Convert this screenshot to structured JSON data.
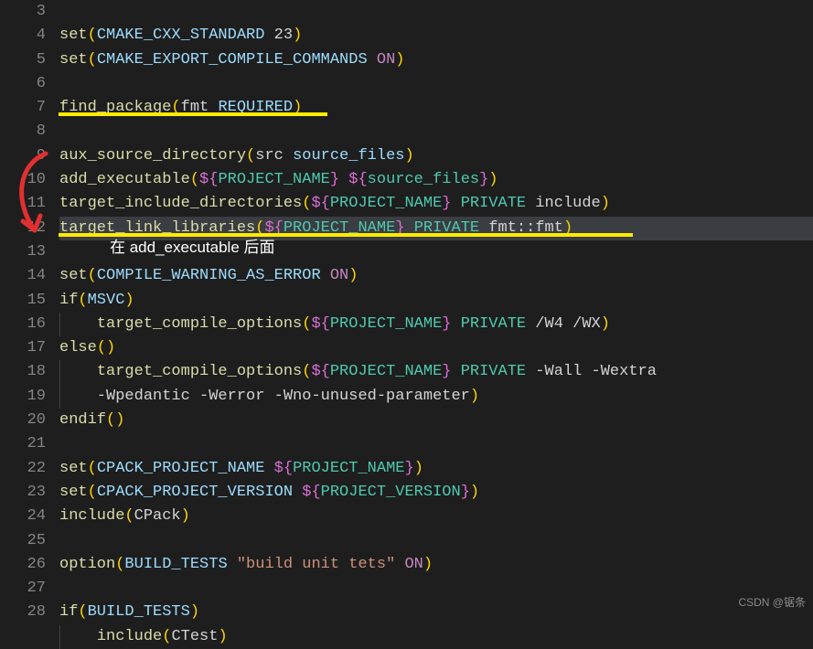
{
  "line_numbers": [
    "3",
    "4",
    "5",
    "6",
    "7",
    "8",
    "9",
    "10",
    "11",
    "12",
    "13",
    "14",
    "15",
    "16",
    "17",
    "18",
    "19",
    "20",
    "21",
    "22",
    "23",
    "24",
    "25",
    "26",
    "27",
    "28"
  ],
  "code": {
    "l4": [
      {
        "t": "set",
        "c": "tk-fn"
      },
      {
        "t": "(",
        "c": "tk-pn"
      },
      {
        "t": "CMAKE_CXX_STANDARD ",
        "c": "tk-var"
      },
      {
        "t": "23",
        "c": "tk-def"
      },
      {
        "t": ")",
        "c": "tk-pn"
      }
    ],
    "l5": [
      {
        "t": "set",
        "c": "tk-fn"
      },
      {
        "t": "(",
        "c": "tk-pn"
      },
      {
        "t": "CMAKE_EXPORT_COMPILE_COMMANDS ",
        "c": "tk-var"
      },
      {
        "t": "ON",
        "c": "tk-kw"
      },
      {
        "t": ")",
        "c": "tk-pn"
      }
    ],
    "l7": [
      {
        "t": "find_package",
        "c": "tk-fn"
      },
      {
        "t": "(",
        "c": "tk-pn"
      },
      {
        "t": "fmt ",
        "c": "tk-def"
      },
      {
        "t": "REQUIRED",
        "c": "tk-var"
      },
      {
        "t": ")",
        "c": "tk-pn"
      }
    ],
    "l9": [
      {
        "t": "aux_source_directory",
        "c": "tk-fn"
      },
      {
        "t": "(",
        "c": "tk-pn"
      },
      {
        "t": "src ",
        "c": "tk-def"
      },
      {
        "t": "source_files",
        "c": "tk-var"
      },
      {
        "t": ")",
        "c": "tk-pn"
      }
    ],
    "l10": [
      {
        "t": "add_executable",
        "c": "tk-fn"
      },
      {
        "t": "(",
        "c": "tk-pn"
      },
      {
        "t": "${",
        "c": "tk-pn2"
      },
      {
        "t": "PROJECT_NAME",
        "c": "tk-varb"
      },
      {
        "t": "}",
        "c": "tk-pn2"
      },
      {
        "t": " ",
        "c": "tk-def"
      },
      {
        "t": "${",
        "c": "tk-pn2"
      },
      {
        "t": "source_files",
        "c": "tk-varb"
      },
      {
        "t": "}",
        "c": "tk-pn2"
      },
      {
        "t": ")",
        "c": "tk-pn"
      }
    ],
    "l11": [
      {
        "t": "target_include_directories",
        "c": "tk-fn"
      },
      {
        "t": "(",
        "c": "tk-pn"
      },
      {
        "t": "${",
        "c": "tk-pn2"
      },
      {
        "t": "PROJECT_NAME",
        "c": "tk-varb"
      },
      {
        "t": "}",
        "c": "tk-pn2"
      },
      {
        "t": " ",
        "c": "tk-def"
      },
      {
        "t": "PRIVATE",
        "c": "tk-varb"
      },
      {
        "t": " include",
        "c": "tk-def"
      },
      {
        "t": ")",
        "c": "tk-pn"
      }
    ],
    "l12": [
      {
        "t": "target_link_libraries",
        "c": "tk-fn"
      },
      {
        "t": "(",
        "c": "tk-pn"
      },
      {
        "t": "${",
        "c": "tk-pn2"
      },
      {
        "t": "PROJECT_NAME",
        "c": "tk-varb"
      },
      {
        "t": "}",
        "c": "tk-pn2"
      },
      {
        "t": " ",
        "c": "tk-def"
      },
      {
        "t": "PRIVATE",
        "c": "tk-varb"
      },
      {
        "t": " fmt::fmt",
        "c": "tk-def"
      },
      {
        "t": ")",
        "c": "tk-pn"
      }
    ],
    "l14": [
      {
        "t": "set",
        "c": "tk-fn"
      },
      {
        "t": "(",
        "c": "tk-pn"
      },
      {
        "t": "COMPILE_WARNING_AS_ERROR ",
        "c": "tk-var"
      },
      {
        "t": "ON",
        "c": "tk-kw"
      },
      {
        "t": ")",
        "c": "tk-pn"
      }
    ],
    "l15": [
      {
        "t": "if",
        "c": "tk-fn"
      },
      {
        "t": "(",
        "c": "tk-pn"
      },
      {
        "t": "MSVC",
        "c": "tk-var"
      },
      {
        "t": ")",
        "c": "tk-pn"
      }
    ],
    "l16": [
      {
        "t": "    ",
        "c": "tk-def"
      },
      {
        "t": "target_compile_options",
        "c": "tk-fn"
      },
      {
        "t": "(",
        "c": "tk-pn"
      },
      {
        "t": "${",
        "c": "tk-pn2"
      },
      {
        "t": "PROJECT_NAME",
        "c": "tk-varb"
      },
      {
        "t": "}",
        "c": "tk-pn2"
      },
      {
        "t": " ",
        "c": "tk-def"
      },
      {
        "t": "PRIVATE",
        "c": "tk-varb"
      },
      {
        "t": " /W4 /WX",
        "c": "tk-def"
      },
      {
        "t": ")",
        "c": "tk-pn"
      }
    ],
    "l17": [
      {
        "t": "else",
        "c": "tk-fn"
      },
      {
        "t": "()",
        "c": "tk-pn"
      }
    ],
    "l18a": [
      {
        "t": "    ",
        "c": "tk-def"
      },
      {
        "t": "target_compile_options",
        "c": "tk-fn"
      },
      {
        "t": "(",
        "c": "tk-pn"
      },
      {
        "t": "${",
        "c": "tk-pn2"
      },
      {
        "t": "PROJECT_NAME",
        "c": "tk-varb"
      },
      {
        "t": "}",
        "c": "tk-pn2"
      },
      {
        "t": " ",
        "c": "tk-def"
      },
      {
        "t": "PRIVATE",
        "c": "tk-varb"
      },
      {
        "t": " -Wall -Wextra",
        "c": "tk-def"
      }
    ],
    "l18b": [
      {
        "t": "    -Wpedantic -Werror -Wno-unused-parameter",
        "c": "tk-def"
      },
      {
        "t": ")",
        "c": "tk-pn"
      }
    ],
    "l19": [
      {
        "t": "endif",
        "c": "tk-fn"
      },
      {
        "t": "()",
        "c": "tk-pn"
      }
    ],
    "l21": [
      {
        "t": "set",
        "c": "tk-fn"
      },
      {
        "t": "(",
        "c": "tk-pn"
      },
      {
        "t": "CPACK_PROJECT_NAME ",
        "c": "tk-var"
      },
      {
        "t": "${",
        "c": "tk-pn2"
      },
      {
        "t": "PROJECT_NAME",
        "c": "tk-varb"
      },
      {
        "t": "}",
        "c": "tk-pn2"
      },
      {
        "t": ")",
        "c": "tk-pn"
      }
    ],
    "l22": [
      {
        "t": "set",
        "c": "tk-fn"
      },
      {
        "t": "(",
        "c": "tk-pn"
      },
      {
        "t": "CPACK_PROJECT_VERSION ",
        "c": "tk-var"
      },
      {
        "t": "${",
        "c": "tk-pn2"
      },
      {
        "t": "PROJECT_VERSION",
        "c": "tk-varb"
      },
      {
        "t": "}",
        "c": "tk-pn2"
      },
      {
        "t": ")",
        "c": "tk-pn"
      }
    ],
    "l23": [
      {
        "t": "include",
        "c": "tk-fn"
      },
      {
        "t": "(",
        "c": "tk-pn"
      },
      {
        "t": "CPack",
        "c": "tk-def"
      },
      {
        "t": ")",
        "c": "tk-pn"
      }
    ],
    "l25": [
      {
        "t": "option",
        "c": "tk-fn"
      },
      {
        "t": "(",
        "c": "tk-pn"
      },
      {
        "t": "BUILD_TESTS ",
        "c": "tk-var"
      },
      {
        "t": "\"build unit tets\"",
        "c": "tk-str"
      },
      {
        "t": " ",
        "c": "tk-def"
      },
      {
        "t": "ON",
        "c": "tk-kw"
      },
      {
        "t": ")",
        "c": "tk-pn"
      }
    ],
    "l27": [
      {
        "t": "if",
        "c": "tk-fn"
      },
      {
        "t": "(",
        "c": "tk-pn"
      },
      {
        "t": "BUILD_TESTS",
        "c": "tk-var"
      },
      {
        "t": ")",
        "c": "tk-pn"
      }
    ],
    "l28": [
      {
        "t": "    ",
        "c": "tk-def"
      },
      {
        "t": "include",
        "c": "tk-fn"
      },
      {
        "t": "(",
        "c": "tk-pn"
      },
      {
        "t": "CTest",
        "c": "tk-def"
      },
      {
        "t": ")",
        "c": "tk-pn"
      }
    ]
  },
  "annotation": {
    "text": "在 add_executable 后面"
  },
  "watermark": "CSDN @锯条"
}
